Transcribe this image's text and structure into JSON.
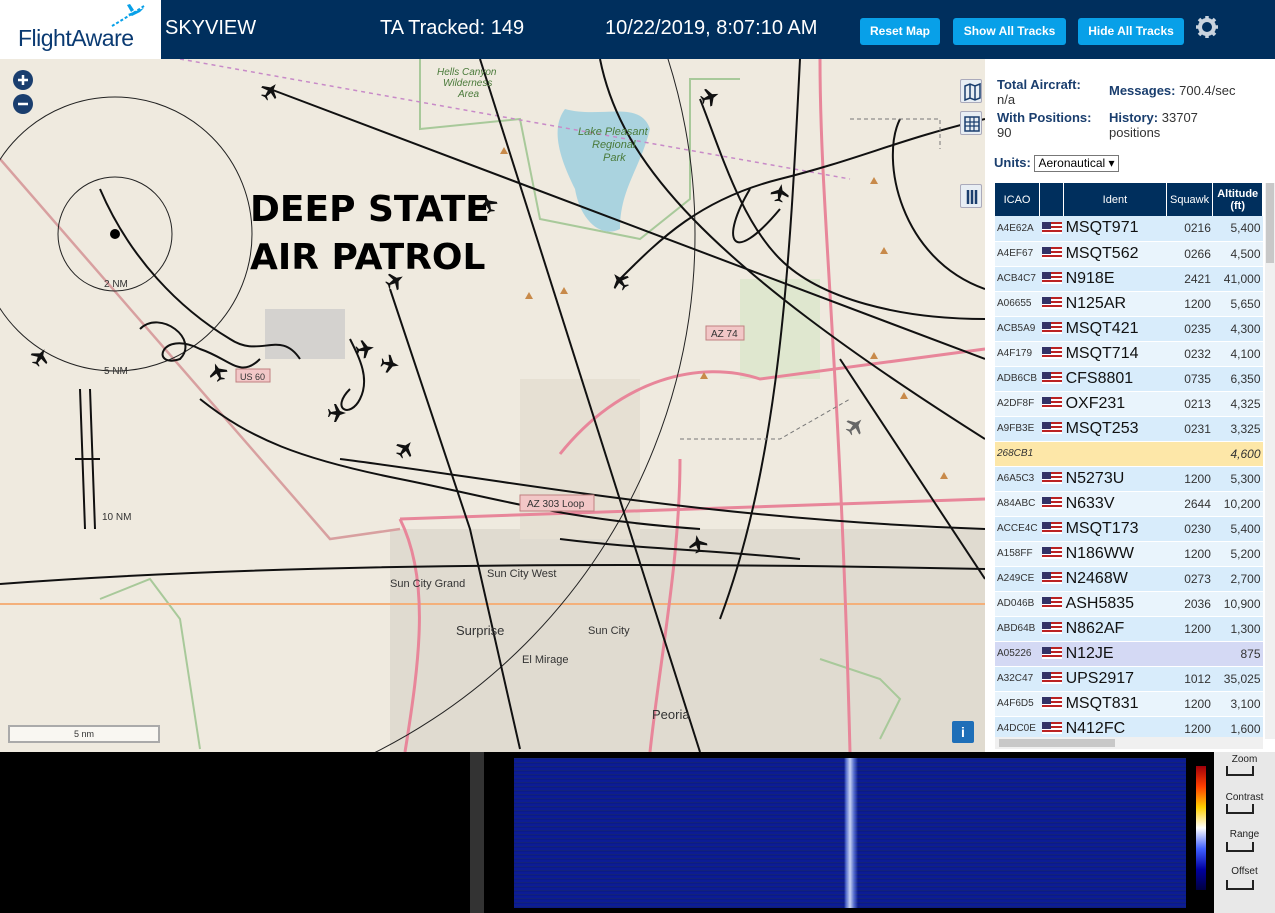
{
  "header": {
    "logo_text": "FlightAware",
    "site_name": "SKYVIEW",
    "tracked": "TA Tracked: 149",
    "datetime": "10/22/2019, 8:07:10 AM",
    "buttons": {
      "reset": "Reset Map",
      "show": "Show All Tracks",
      "hide": "Hide All Tracks"
    },
    "accent": "#08a0e8",
    "bar_color": "#002f5d"
  },
  "map": {
    "overlay_line1": "DEEP STATE",
    "overlay_line2": "AIR PATROL",
    "range_labels": [
      "2 NM",
      "5 NM",
      "10 NM"
    ],
    "places": [
      {
        "name": "Hells Canyon\nWilderness\nArea"
      },
      {
        "name": "Lake Pleasant\nRegional\nPark"
      },
      {
        "name": "Sun City Grand"
      },
      {
        "name": "Sun City West"
      },
      {
        "name": "Surprise"
      },
      {
        "name": "Sun City"
      },
      {
        "name": "El Mirage"
      },
      {
        "name": "Peoria"
      }
    ],
    "road_labels": [
      "AZ 74",
      "AZ 303 Loop",
      "US 60"
    ],
    "scale_label": "5 nm"
  },
  "panel": {
    "total_aircraft_label": "Total Aircraft:",
    "total_aircraft_value": "n/a",
    "with_positions_label": "With Positions:",
    "with_positions_value": "90",
    "messages_label": "Messages:",
    "messages_value": "700.4/sec",
    "history_label": "History:",
    "history_value": "33707",
    "history_unit": "positions",
    "units_label": "Units:",
    "units_value": "Aeronautical",
    "columns": [
      "ICAO",
      "",
      "Ident",
      "Squawk",
      "Altitude\n(ft)"
    ],
    "rows": [
      {
        "icao": "A4E62A",
        "ident": "MSQT971",
        "squawk": "0216",
        "alt": "5,400"
      },
      {
        "icao": "A4EF67",
        "ident": "MSQT562",
        "squawk": "0266",
        "alt": "4,500"
      },
      {
        "icao": "ACB4C7",
        "ident": "N918E",
        "squawk": "2421",
        "alt": "41,000"
      },
      {
        "icao": "A06655",
        "ident": "N125AR",
        "squawk": "1200",
        "alt": "5,650"
      },
      {
        "icao": "ACB5A9",
        "ident": "MSQT421",
        "squawk": "0235",
        "alt": "4,300"
      },
      {
        "icao": "A4F179",
        "ident": "MSQT714",
        "squawk": "0232",
        "alt": "4,100"
      },
      {
        "icao": "ADB6CB",
        "ident": "CFS8801",
        "squawk": "0735",
        "alt": "6,350"
      },
      {
        "icao": "A2DF8F",
        "ident": "OXF231",
        "squawk": "0213",
        "alt": "4,325"
      },
      {
        "icao": "A9FB3E",
        "ident": "MSQT253",
        "squawk": "0231",
        "alt": "3,325"
      },
      {
        "icao": "268CB1",
        "ident": "",
        "squawk": "",
        "alt": "4,600"
      },
      {
        "icao": "A6A5C3",
        "ident": "N5273U",
        "squawk": "1200",
        "alt": "5,300"
      },
      {
        "icao": "A84ABC",
        "ident": "N633V",
        "squawk": "2644",
        "alt": "10,200"
      },
      {
        "icao": "ACCE4C",
        "ident": "MSQT173",
        "squawk": "0230",
        "alt": "5,400"
      },
      {
        "icao": "A158FF",
        "ident": "N186WW",
        "squawk": "1200",
        "alt": "5,200"
      },
      {
        "icao": "A249CE",
        "ident": "N2468W",
        "squawk": "0273",
        "alt": "2,700"
      },
      {
        "icao": "AD046B",
        "ident": "ASH5835",
        "squawk": "2036",
        "alt": "10,900"
      },
      {
        "icao": "ABD64B",
        "ident": "N862AF",
        "squawk": "1200",
        "alt": "1,300"
      },
      {
        "icao": "A05226",
        "ident": "N12JE",
        "squawk": "",
        "alt": "875"
      },
      {
        "icao": "A32C47",
        "ident": "UPS2917",
        "squawk": "1012",
        "alt": "35,025"
      },
      {
        "icao": "A4F6D5",
        "ident": "MSQT831",
        "squawk": "1200",
        "alt": "3,100"
      },
      {
        "icao": "A4DC0E",
        "ident": "N412FC",
        "squawk": "1200",
        "alt": "1,600"
      }
    ]
  },
  "spectrum": {
    "controls": [
      "Zoom",
      "Contrast",
      "Range",
      "Offset"
    ]
  }
}
